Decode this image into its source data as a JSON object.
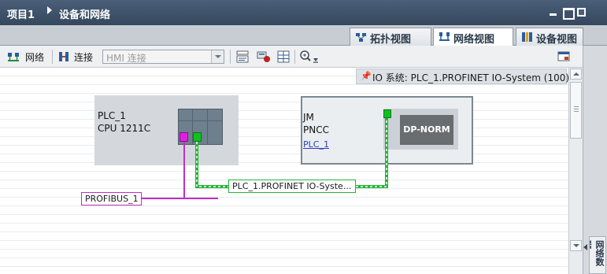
{
  "titlebar": {
    "project": "项目1",
    "section": "设备和网络"
  },
  "tabs": [
    {
      "label": "拓扑视图",
      "icon": "topology-view-icon",
      "active": false
    },
    {
      "label": "网络视图",
      "icon": "network-view-icon",
      "active": true
    },
    {
      "label": "设备视图",
      "icon": "device-view-icon",
      "active": false
    }
  ],
  "toolbar": {
    "network_label": "网络",
    "connection_label": "连接",
    "hmi_connection_value": "HMI 连接"
  },
  "io_system": {
    "text": "IO 系统: PLC_1.PROFINET IO-System (100)"
  },
  "devices": {
    "plc": {
      "name": "PLC_1",
      "type": "CPU 1211C"
    },
    "jm": {
      "name": "JM",
      "type": "PNCC",
      "link": "PLC_1",
      "module": "DP-NORM"
    }
  },
  "networks": {
    "profinet_label": "PLC_1.PROFINET IO-Syste...",
    "profibus_label": "PROFIBUS_1"
  },
  "side_panel": {
    "tab_label": "网络数据"
  },
  "colors": {
    "profinet": "#22b534",
    "profibus": "#c22fc0",
    "titlebar": "#3f536b"
  }
}
